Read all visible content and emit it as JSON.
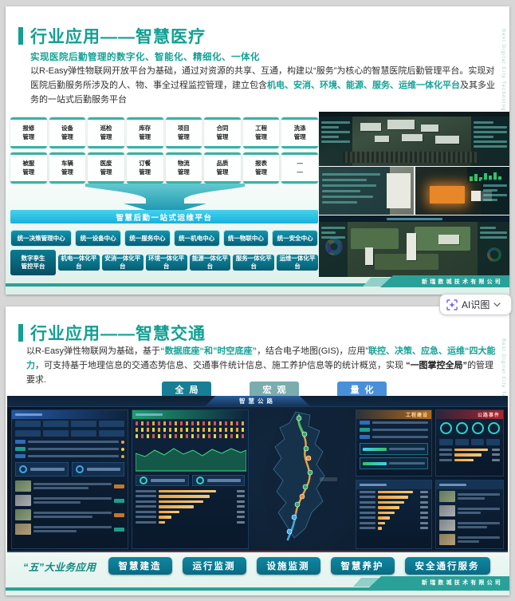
{
  "viewer": {
    "ai_button": {
      "label": "AI识图"
    }
  },
  "slide1": {
    "title": "行业应用——智慧医疗",
    "subtitle": "实现医院后勤管理的数字化、智能化、精细化、一体化",
    "body_segments": [
      {
        "style": "normal",
        "text": "以R-Easy弹性物联网开放平台为基础，通过对资源的共享、互通，构建以“服务”为核心的智慧医院后勤管理平台。实现对医院后勤服务所涉及的人、物、事全过程监控管理，建立包含"
      },
      {
        "style": "teal",
        "text": "机电、安消、环境、能源、服务、运维一体化平台"
      },
      {
        "style": "normal",
        "text": "及其多业务的一站式后勤服务平台"
      }
    ],
    "side_text": "Best Digital City Technology Co., Ltd",
    "modules": [
      "报修\n管理",
      "设备\n管理",
      "巡检\n管理",
      "库存\n管理",
      "项目\n管理",
      "合同\n管理",
      "工程\n管理",
      "洗涤\n管理",
      "被服\n管理",
      "车辆\n管理",
      "医废\n管理",
      "订餐\n管理",
      "物流\n管理",
      "品质\n管理",
      "报表\n管理",
      "—\n—"
    ],
    "platform_bar": "智慧后勤一站式运维平台",
    "centers": [
      "统一决策管理中心",
      "统一设备中心",
      "统一服务中心",
      "统一机电中心",
      "统一物联中心",
      "统一安全中心"
    ],
    "platforms": [
      "数字孪生\n管控平台",
      "机电一体化平台",
      "安消一体化平台",
      "环境一体化平台",
      "能源一体化平台",
      "服务一体化平台",
      "运维一体化平台"
    ],
    "footer_company": "新瑞数城技术有限公司"
  },
  "slide2": {
    "title": "行业应用——智慧交通",
    "body_segments": [
      {
        "style": "normal",
        "text": "以R-Easy弹性物联网为基础，基于"
      },
      {
        "style": "teal",
        "text": "“数据底座“和”时空底座”"
      },
      {
        "style": "normal",
        "text": "，结合电子地图(GIS)，应用”"
      },
      {
        "style": "teal",
        "text": "联控、决策、应急、运维“四大能力"
      },
      {
        "style": "normal",
        "text": "，可支持基于地理信息的交通态势信息、交通事件统计信息、施工养护信息等的统计概览，实现 "
      },
      {
        "style": "bold",
        "text": "“一图掌控全局”"
      },
      {
        "style": "normal",
        "text": "的管理要求."
      }
    ],
    "mode_buttons": [
      "全局",
      "宏观",
      "量化"
    ],
    "dashboard": {
      "title": "智慧公路",
      "panel_engineering": "工程建设",
      "panel_events": "公路事件"
    },
    "biz_label": "“五”大业务应用",
    "biz_buttons": [
      "智慧建造",
      "运行监测",
      "设施监测",
      "智慧养护",
      "安全通行服务"
    ],
    "footer_company": "新瑞数城技术有限公司",
    "side_text": "Best Digital City Technology Co., Ltd"
  },
  "colors": {
    "teal_accent": "#12a093",
    "cyan_bar": "#27c1e5",
    "dark_teal_button": "#0b7f96",
    "footer_teal": "#2aa198",
    "mode_global": "#177e95",
    "mode_macro": "#7badaf",
    "mode_quant": "#4a90d9"
  }
}
